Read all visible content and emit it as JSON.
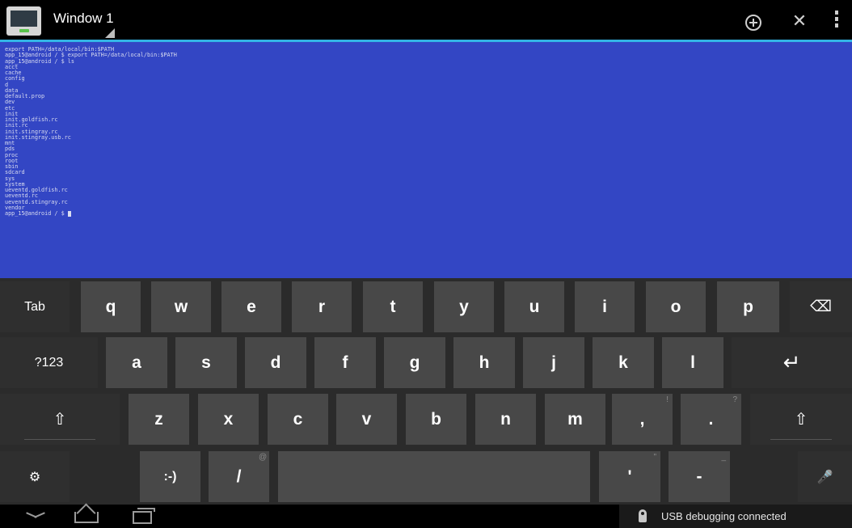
{
  "window": {
    "title": "Window 1"
  },
  "actionbar": {
    "add_glyph": "⊕",
    "close_glyph": "✕"
  },
  "terminal": {
    "lines": [
      "export PATH=/data/local/bin:$PATH",
      "app_15@android / $ export PATH=/data/local/bin:$PATH",
      "app_15@android / $ ls",
      "acct",
      "cache",
      "config",
      "d",
      "data",
      "default.prop",
      "dev",
      "etc",
      "init",
      "init.goldfish.rc",
      "init.rc",
      "init.stingray.rc",
      "init.stingray.usb.rc",
      "mnt",
      "pds",
      "proc",
      "root",
      "sbin",
      "sdcard",
      "sys",
      "system",
      "ueventd.goldfish.rc",
      "ueventd.rc",
      "ueventd.stingray.rc",
      "vendor",
      "app_15@android / $ "
    ]
  },
  "keyboard": {
    "row1": [
      "Tab",
      "q",
      "w",
      "e",
      "r",
      "t",
      "y",
      "u",
      "i",
      "o",
      "p"
    ],
    "row2": [
      "?123",
      "a",
      "s",
      "d",
      "f",
      "g",
      "h",
      "j",
      "k",
      "l"
    ],
    "row3": [
      "z",
      "x",
      "c",
      "v",
      "b",
      "n",
      "m",
      ",",
      "."
    ],
    "row3_hints": {
      "comma": "!",
      "period": "?"
    },
    "row4": {
      "smiley": ":-)",
      "slash": "/",
      "slash_hint": "@",
      "apostrophe": "'",
      "apostrophe_hint": "\"",
      "dash": "-",
      "dash_hint": "_"
    },
    "icons": {
      "backspace": "⌫",
      "enter": "↵",
      "shift": "⇧",
      "settings": "⚙",
      "mic": "🎤"
    }
  },
  "status": {
    "notification": "USB debugging connected"
  }
}
